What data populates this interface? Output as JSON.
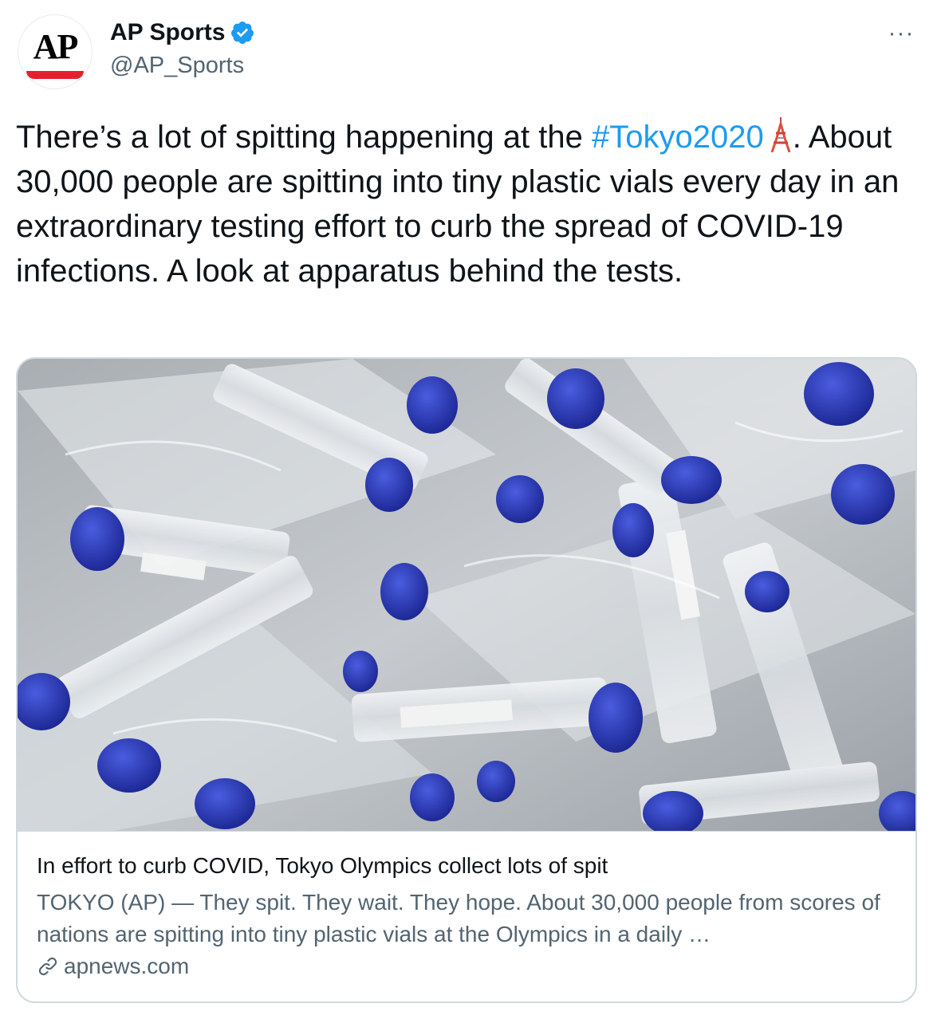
{
  "author": {
    "avatar_text": "AP",
    "display_name": "AP Sports",
    "handle": "@AP_Sports",
    "verified": true,
    "brand_color": "#e5202e"
  },
  "menu": {
    "more_label": "···"
  },
  "tweet": {
    "text_before": "There’s a lot of spitting happening at the ",
    "hashtag": "#Tokyo2020",
    "text_after": ". About 30,000 people are spitting into tiny plastic vials every day in an extraordinary testing effort to curb the spread of COVID-19 infections. A look at apparatus behind the tests.",
    "emoji_icon": "tokyo-tower-icon"
  },
  "card": {
    "image_alt": "plastic-vials-photo",
    "title": "In effort to curb COVID, Tokyo Olympics collect lots of spit",
    "description": "TOKYO (AP) — They spit. They wait. They hope. About 30,000 people from scores of nations are spitting into tiny plastic vials at the Olympics in a daily …",
    "domain": "apnews.com",
    "domain_icon": "link-icon"
  },
  "colors": {
    "link_blue": "#1d9bf0",
    "secondary_text": "#536471",
    "primary_text": "#0f1419",
    "border": "#cfd9de",
    "vial_cap_blue": "#1f2fb0"
  }
}
